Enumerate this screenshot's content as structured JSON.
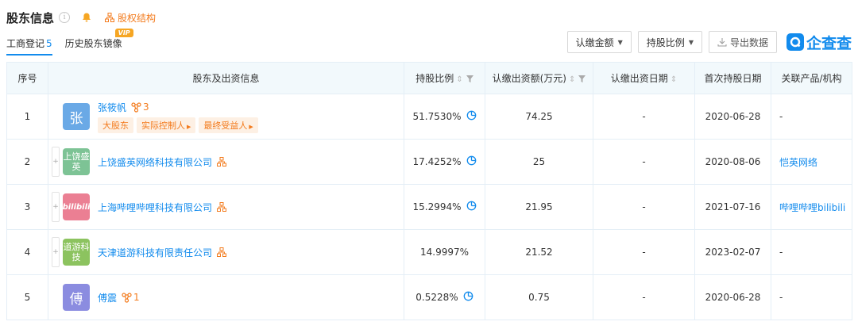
{
  "header": {
    "title": "股东信息",
    "equity_link": "股权结构"
  },
  "tabs": [
    {
      "label": "工商登记",
      "count": "5"
    },
    {
      "label": "历史股东镜像",
      "badge": "VIP"
    }
  ],
  "toolbar": {
    "subscribed_amount": "认缴金额",
    "share_ratio": "持股比例",
    "export": "导出数据",
    "logo_text": "企查查"
  },
  "table": {
    "headers": {
      "index": "序号",
      "holder": "股东及出资信息",
      "ratio": "持股比例",
      "amount": "认缴出资额(万元)",
      "date": "认缴出资日期",
      "first_date": "首次持股日期",
      "related": "关联产品/机构"
    },
    "rows": [
      {
        "index": "1",
        "avatar_text": "张",
        "avatar_color": "#6aa9e6",
        "name": "张筱帆",
        "relation_count": "3",
        "tags": [
          "大股东",
          "实际控制人",
          "最终受益人"
        ],
        "ratio": "51.7530%",
        "amount": "74.25",
        "date": "-",
        "first_date": "2020-06-28",
        "related": "-"
      },
      {
        "index": "2",
        "avatar_text": "上饶盛英",
        "avatar_color": "#7dc395",
        "name": "上饶盛英网络科技有限公司",
        "ratio": "17.4252%",
        "amount": "25",
        "date": "-",
        "first_date": "2020-08-06",
        "related": "恺英网络"
      },
      {
        "index": "3",
        "avatar_text": "bilibili",
        "avatar_color": "#eb7f93",
        "name": "上海哔哩哔哩科技有限公司",
        "ratio": "15.2994%",
        "amount": "21.95",
        "date": "-",
        "first_date": "2021-07-16",
        "related": "哔哩哔哩bilibili"
      },
      {
        "index": "4",
        "avatar_text": "道游科技",
        "avatar_color": "#8cc35f",
        "name": "天津道游科技有限责任公司",
        "ratio": "14.9997%",
        "amount": "21.52",
        "date": "-",
        "first_date": "2023-02-07",
        "related": "-"
      },
      {
        "index": "5",
        "avatar_text": "傅",
        "avatar_color": "#8b8ce0",
        "name": "傅震",
        "relation_count": "1",
        "ratio": "0.5228%",
        "amount": "0.75",
        "date": "-",
        "first_date": "2020-06-28",
        "related": "-"
      }
    ]
  },
  "colors": {
    "accent": "#128bed",
    "orange": "#f37b1d",
    "header_bg": "#f2f9fc"
  }
}
